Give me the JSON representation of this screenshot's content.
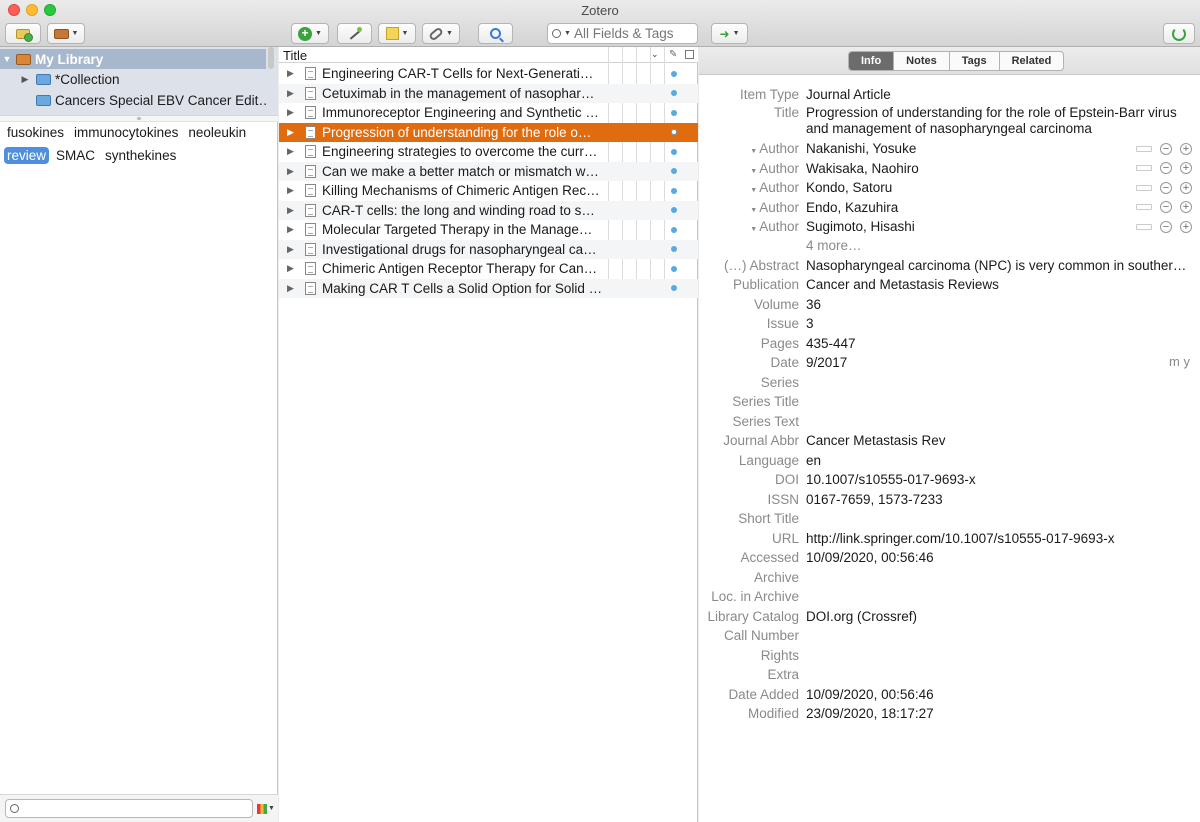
{
  "window": {
    "title": "Zotero"
  },
  "toolbar": {
    "search_placeholder": "All Fields & Tags"
  },
  "collections": {
    "items": [
      {
        "label": "My Library"
      },
      {
        "label": "*Collection"
      },
      {
        "label": "Cancers Special EBV Cancer Edit…"
      }
    ]
  },
  "tags": {
    "line1": [
      "fusokines",
      "immunocytokines",
      "neoleukin"
    ],
    "line2": [
      "review",
      "SMAC",
      "synthekines"
    ]
  },
  "items_list": {
    "column_title": "Title",
    "rows": [
      "Engineering CAR-T Cells for Next-Generati…",
      "Cetuximab in the management of nasophar…",
      "Immunoreceptor Engineering and Synthetic …",
      "Progression of understanding for the role o…",
      "Engineering strategies to overcome the curr…",
      "Can we make a better match or mismatch w…",
      "Killing Mechanisms of Chimeric Antigen Rec…",
      "CAR-T cells: the long and winding road to s…",
      "Molecular Targeted Therapy in the Manage…",
      "Investigational drugs for nasopharyngeal ca…",
      "Chimeric Antigen Receptor Therapy for Can…",
      "Making CAR T Cells a Solid Option for Solid …"
    ],
    "selected_index": 3
  },
  "item_pane": {
    "tabs": [
      "Info",
      "Notes",
      "Tags",
      "Related"
    ],
    "item_type_label": "Item Type",
    "item_type": "Journal Article",
    "title_label": "Title",
    "title": "Progression of understanding for the role of Epstein-Barr virus and management of nasopharyngeal carcinoma",
    "author_label": "Author",
    "authors": [
      "Nakanishi, Yosuke",
      "Wakisaka, Naohiro",
      "Kondo, Satoru",
      "Endo, Kazuhira",
      "Sugimoto, Hisashi"
    ],
    "more_authors": "4 more…",
    "date_format_hint": "m y",
    "fields": [
      {
        "label": "(…) Abstract",
        "value": "Nasopharyngeal carcinoma (NPC) is very common in souther…"
      },
      {
        "label": "Publication",
        "value": "Cancer and Metastasis Reviews"
      },
      {
        "label": "Volume",
        "value": "36"
      },
      {
        "label": "Issue",
        "value": "3"
      },
      {
        "label": "Pages",
        "value": "435-447"
      },
      {
        "label": "Date",
        "value": "9/2017"
      },
      {
        "label": "Series",
        "value": ""
      },
      {
        "label": "Series Title",
        "value": ""
      },
      {
        "label": "Series Text",
        "value": ""
      },
      {
        "label": "Journal Abbr",
        "value": "Cancer Metastasis Rev"
      },
      {
        "label": "Language",
        "value": "en"
      },
      {
        "label": "DOI",
        "value": "10.1007/s10555-017-9693-x"
      },
      {
        "label": "ISSN",
        "value": "0167-7659, 1573-7233"
      },
      {
        "label": "Short Title",
        "value": ""
      },
      {
        "label": "URL",
        "value": "http://link.springer.com/10.1007/s10555-017-9693-x"
      },
      {
        "label": "Accessed",
        "value": "10/09/2020, 00:56:46"
      },
      {
        "label": "Archive",
        "value": ""
      },
      {
        "label": "Loc. in Archive",
        "value": ""
      },
      {
        "label": "Library Catalog",
        "value": "DOI.org (Crossref)"
      },
      {
        "label": "Call Number",
        "value": ""
      },
      {
        "label": "Rights",
        "value": ""
      },
      {
        "label": "Extra",
        "value": ""
      },
      {
        "label": "Date Added",
        "value": "10/09/2020, 00:56:46"
      },
      {
        "label": "Modified",
        "value": "23/09/2020, 18:17:27"
      }
    ]
  },
  "colors": {
    "selected_item": "#e06c0f",
    "selected_collection": "#a7b7cc",
    "selected_tag": "#4f8fdb"
  }
}
